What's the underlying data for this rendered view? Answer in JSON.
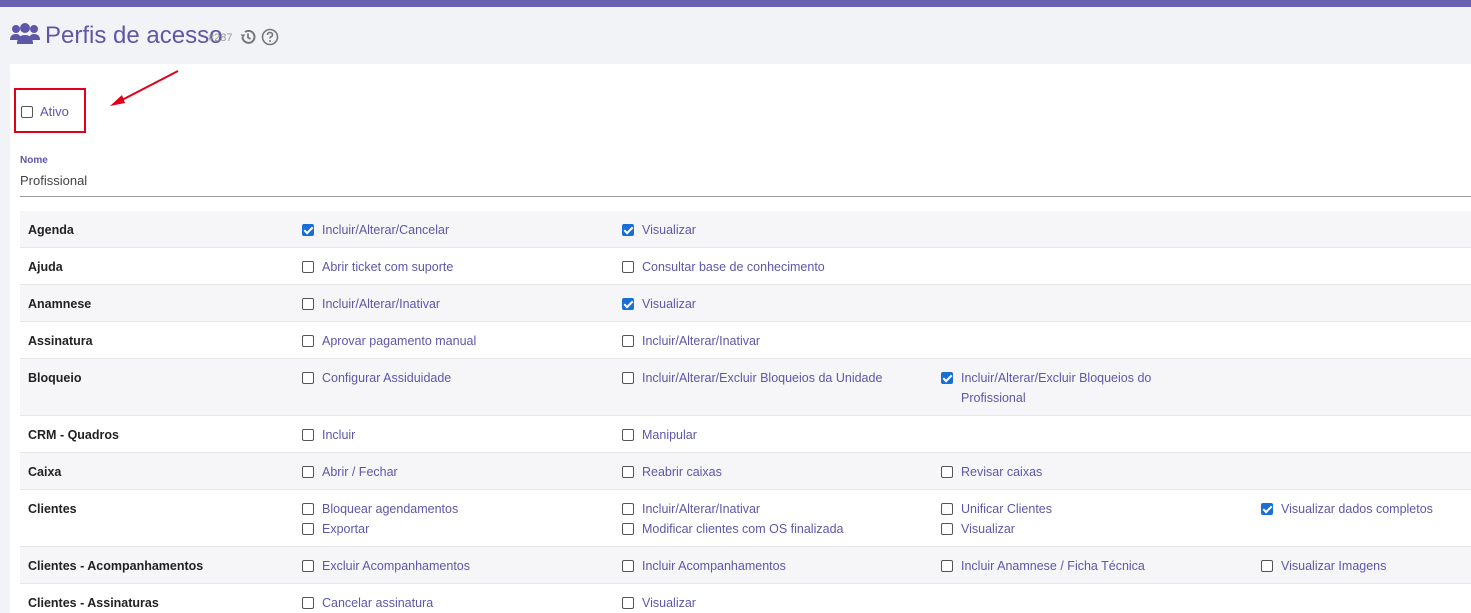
{
  "header": {
    "title": "Perfis de acesso",
    "record_id": "#287"
  },
  "form": {
    "ativo_label": "Ativo",
    "ativo_checked": false,
    "nome_label": "Nome",
    "nome_value": "Profissional"
  },
  "colors": {
    "accent": "#5e57a8",
    "topbar": "#6a62b0",
    "checkbox_checked": "#1a6fd6",
    "highlight": "#e0001b"
  },
  "permissions": [
    {
      "name": "Agenda",
      "options": [
        {
          "label": "Incluir/Alterar/Cancelar",
          "checked": true
        },
        {
          "label": "Visualizar",
          "checked": true
        }
      ]
    },
    {
      "name": "Ajuda",
      "options": [
        {
          "label": "Abrir ticket com suporte",
          "checked": false
        },
        {
          "label": "Consultar base de conhecimento",
          "checked": false
        }
      ]
    },
    {
      "name": "Anamnese",
      "options": [
        {
          "label": "Incluir/Alterar/Inativar",
          "checked": false
        },
        {
          "label": "Visualizar",
          "checked": true
        }
      ]
    },
    {
      "name": "Assinatura",
      "options": [
        {
          "label": "Aprovar pagamento manual",
          "checked": false
        },
        {
          "label": "Incluir/Alterar/Inativar",
          "checked": false
        }
      ]
    },
    {
      "name": "Bloqueio",
      "options": [
        {
          "label": "Configurar Assiduidade",
          "checked": false
        },
        {
          "label": "Incluir/Alterar/Excluir Bloqueios da Unidade",
          "checked": false
        },
        {
          "label": "Incluir/Alterar/Excluir Bloqueios do Profissional",
          "checked": true
        }
      ]
    },
    {
      "name": "CRM - Quadros",
      "options": [
        {
          "label": "Incluir",
          "checked": false
        },
        {
          "label": "Manipular",
          "checked": false
        }
      ]
    },
    {
      "name": "Caixa",
      "options": [
        {
          "label": "Abrir / Fechar",
          "checked": false
        },
        {
          "label": "Reabrir caixas",
          "checked": false
        },
        {
          "label": "Revisar caixas",
          "checked": false
        }
      ]
    },
    {
      "name": "Clientes",
      "options": [
        {
          "label": "Bloquear agendamentos",
          "checked": false
        },
        {
          "label": "Incluir/Alterar/Inativar",
          "checked": false
        },
        {
          "label": "Unificar Clientes",
          "checked": false
        },
        {
          "label": "Visualizar dados completos",
          "checked": true
        },
        {
          "label": "Exportar",
          "checked": false
        },
        {
          "label": "Modificar clientes com OS finalizada",
          "checked": false
        },
        {
          "label": "Visualizar",
          "checked": false
        }
      ]
    },
    {
      "name": "Clientes - Acompanhamentos",
      "options": [
        {
          "label": "Excluir Acompanhamentos",
          "checked": false
        },
        {
          "label": "Incluir Acompanhamentos",
          "checked": false
        },
        {
          "label": "Incluir Anamnese / Ficha Técnica",
          "checked": false
        },
        {
          "label": "Visualizar Imagens",
          "checked": false
        }
      ]
    },
    {
      "name": "Clientes - Assinaturas",
      "options": [
        {
          "label": "Cancelar assinatura",
          "checked": false
        },
        {
          "label": "Visualizar",
          "checked": false
        }
      ]
    }
  ]
}
